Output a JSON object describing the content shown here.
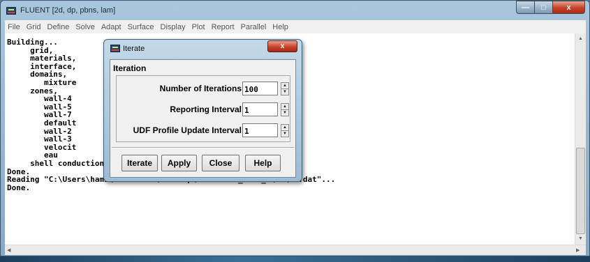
{
  "window": {
    "title": "FLUENT  [2d, dp, pbns, lam]",
    "controls": {
      "minimize": "—",
      "maximize": "□",
      "close": "x"
    }
  },
  "menu": [
    "File",
    "Grid",
    "Define",
    "Solve",
    "Adapt",
    "Surface",
    "Display",
    "Plot",
    "Report",
    "Parallel",
    "Help"
  ],
  "console": {
    "text": "Building...\n     grid,\n     materials,\n     interface,\n     domains,\n        mixture\n     zones,\n        wall-4\n        wall-5\n        wall-7\n        default\n        wall-2\n        wall-3\n        velocit\n        eau\n     shell conduction zones,\nDone.\nReading \"C:\\Users\\hami\\Documents\\Desktop\\Zineddine_2019_2\\M7\\M7.dat\"...\nDone."
  },
  "dialog": {
    "title": "Iterate",
    "close_label": "x",
    "group_label": "Iteration",
    "fields": [
      {
        "label": "Number of Iterations",
        "value": "100"
      },
      {
        "label": "Reporting Interval",
        "value": "1"
      },
      {
        "label": "UDF Profile Update Interval",
        "value": "1"
      }
    ],
    "buttons": {
      "iterate": "Iterate",
      "apply": "Apply",
      "close": "Close",
      "help": "Help"
    }
  },
  "icons": {
    "app": "fluent-icon",
    "spin_up": "▲",
    "spin_down": "▼"
  }
}
